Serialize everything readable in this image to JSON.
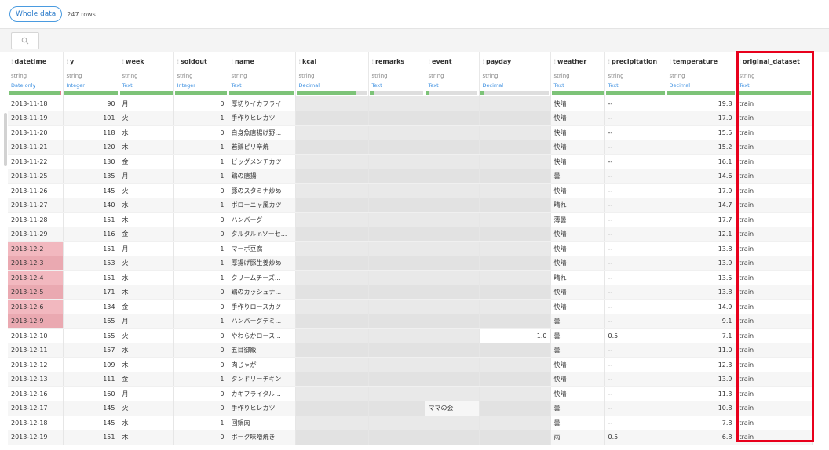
{
  "toolbar": {
    "view_label": "Whole data",
    "row_count": "247 rows"
  },
  "search": {
    "icon": "search-icon"
  },
  "columns": [
    {
      "name": "datetime",
      "type": "string",
      "role": "Date only",
      "valid": 0.97,
      "invalid": 0.03,
      "missing": 0
    },
    {
      "name": "y",
      "type": "string",
      "role": "Integer",
      "valid": 1,
      "invalid": 0,
      "missing": 0
    },
    {
      "name": "week",
      "type": "string",
      "role": "Text",
      "valid": 1,
      "invalid": 0,
      "missing": 0
    },
    {
      "name": "soldout",
      "type": "string",
      "role": "Integer",
      "valid": 1,
      "invalid": 0,
      "missing": 0
    },
    {
      "name": "name",
      "type": "string",
      "role": "Text",
      "valid": 1,
      "invalid": 0,
      "missing": 0
    },
    {
      "name": "kcal",
      "type": "string",
      "role": "Decimal",
      "valid": 0.85,
      "invalid": 0,
      "missing": 0.15
    },
    {
      "name": "remarks",
      "type": "string",
      "role": "Text",
      "valid": 0.1,
      "invalid": 0,
      "missing": 0.9
    },
    {
      "name": "event",
      "type": "string",
      "role": "Text",
      "valid": 0.07,
      "invalid": 0,
      "missing": 0.93
    },
    {
      "name": "payday",
      "type": "string",
      "role": "Decimal",
      "valid": 0.05,
      "invalid": 0,
      "missing": 0.95
    },
    {
      "name": "weather",
      "type": "string",
      "role": "Text",
      "valid": 1,
      "invalid": 0,
      "missing": 0
    },
    {
      "name": "precipitation",
      "type": "string",
      "role": "Text",
      "valid": 1,
      "invalid": 0,
      "missing": 0
    },
    {
      "name": "temperature",
      "type": "string",
      "role": "Decimal",
      "valid": 1,
      "invalid": 0,
      "missing": 0
    },
    {
      "name": "original_dataset",
      "type": "string",
      "role": "Text",
      "valid": 1,
      "invalid": 0,
      "missing": 0
    }
  ],
  "rows": [
    {
      "datetime": "2013-11-18",
      "y": "90",
      "week": "月",
      "soldout": "0",
      "name": "厚切りイカフライ",
      "kcal": "",
      "remarks": "",
      "event": "",
      "payday": "",
      "weather": "快晴",
      "precipitation": "--",
      "temperature": "19.8",
      "original_dataset": "train"
    },
    {
      "datetime": "2013-11-19",
      "y": "101",
      "week": "火",
      "soldout": "1",
      "name": "手作りヒレカツ",
      "kcal": "",
      "remarks": "",
      "event": "",
      "payday": "",
      "weather": "快晴",
      "precipitation": "--",
      "temperature": "17.0",
      "original_dataset": "train"
    },
    {
      "datetime": "2013-11-20",
      "y": "118",
      "week": "水",
      "soldout": "0",
      "name": "白身魚唐揚げ野...",
      "kcal": "",
      "remarks": "",
      "event": "",
      "payday": "",
      "weather": "快晴",
      "precipitation": "--",
      "temperature": "15.5",
      "original_dataset": "train"
    },
    {
      "datetime": "2013-11-21",
      "y": "120",
      "week": "木",
      "soldout": "1",
      "name": "若鶏ピリ辛焼",
      "kcal": "",
      "remarks": "",
      "event": "",
      "payday": "",
      "weather": "快晴",
      "precipitation": "--",
      "temperature": "15.2",
      "original_dataset": "train"
    },
    {
      "datetime": "2013-11-22",
      "y": "130",
      "week": "金",
      "soldout": "1",
      "name": "ビッグメンチカツ",
      "kcal": "",
      "remarks": "",
      "event": "",
      "payday": "",
      "weather": "快晴",
      "precipitation": "--",
      "temperature": "16.1",
      "original_dataset": "train"
    },
    {
      "datetime": "2013-11-25",
      "y": "135",
      "week": "月",
      "soldout": "1",
      "name": "鶏の唐揚",
      "kcal": "",
      "remarks": "",
      "event": "",
      "payday": "",
      "weather": "曇",
      "precipitation": "--",
      "temperature": "14.6",
      "original_dataset": "train"
    },
    {
      "datetime": "2013-11-26",
      "y": "145",
      "week": "火",
      "soldout": "0",
      "name": "豚のスタミナ炒め",
      "kcal": "",
      "remarks": "",
      "event": "",
      "payday": "",
      "weather": "快晴",
      "precipitation": "--",
      "temperature": "17.9",
      "original_dataset": "train"
    },
    {
      "datetime": "2013-11-27",
      "y": "140",
      "week": "水",
      "soldout": "1",
      "name": "ボローニャ風カツ",
      "kcal": "",
      "remarks": "",
      "event": "",
      "payday": "",
      "weather": "晴れ",
      "precipitation": "--",
      "temperature": "14.7",
      "original_dataset": "train"
    },
    {
      "datetime": "2013-11-28",
      "y": "151",
      "week": "木",
      "soldout": "0",
      "name": "ハンバーグ",
      "kcal": "",
      "remarks": "",
      "event": "",
      "payday": "",
      "weather": "薄曇",
      "precipitation": "--",
      "temperature": "17.7",
      "original_dataset": "train"
    },
    {
      "datetime": "2013-11-29",
      "y": "116",
      "week": "金",
      "soldout": "0",
      "name": "タルタルinソーセ...",
      "kcal": "",
      "remarks": "",
      "event": "",
      "payday": "",
      "weather": "快晴",
      "precipitation": "--",
      "temperature": "12.1",
      "original_dataset": "train"
    },
    {
      "datetime": "2013-12-2",
      "y": "151",
      "week": "月",
      "soldout": "1",
      "name": "マーボ豆腐",
      "kcal": "",
      "remarks": "",
      "event": "",
      "payday": "",
      "weather": "快晴",
      "precipitation": "--",
      "temperature": "13.8",
      "original_dataset": "train",
      "invalid_datetime": true
    },
    {
      "datetime": "2013-12-3",
      "y": "153",
      "week": "火",
      "soldout": "1",
      "name": "厚揚げ豚生姜炒め",
      "kcal": "",
      "remarks": "",
      "event": "",
      "payday": "",
      "weather": "快晴",
      "precipitation": "--",
      "temperature": "13.9",
      "original_dataset": "train",
      "invalid_datetime": true
    },
    {
      "datetime": "2013-12-4",
      "y": "151",
      "week": "水",
      "soldout": "1",
      "name": "クリームチーズ...",
      "kcal": "",
      "remarks": "",
      "event": "",
      "payday": "",
      "weather": "晴れ",
      "precipitation": "--",
      "temperature": "13.5",
      "original_dataset": "train",
      "invalid_datetime": true
    },
    {
      "datetime": "2013-12-5",
      "y": "171",
      "week": "木",
      "soldout": "0",
      "name": "鶏のカッシュナ...",
      "kcal": "",
      "remarks": "",
      "event": "",
      "payday": "",
      "weather": "快晴",
      "precipitation": "--",
      "temperature": "13.8",
      "original_dataset": "train",
      "invalid_datetime": true
    },
    {
      "datetime": "2013-12-6",
      "y": "134",
      "week": "金",
      "soldout": "0",
      "name": "手作りロースカツ",
      "kcal": "",
      "remarks": "",
      "event": "",
      "payday": "",
      "weather": "快晴",
      "precipitation": "--",
      "temperature": "14.9",
      "original_dataset": "train",
      "invalid_datetime": true
    },
    {
      "datetime": "2013-12-9",
      "y": "165",
      "week": "月",
      "soldout": "1",
      "name": "ハンバーグデミ...",
      "kcal": "",
      "remarks": "",
      "event": "",
      "payday": "",
      "weather": "曇",
      "precipitation": "--",
      "temperature": "9.1",
      "original_dataset": "train",
      "invalid_datetime": true
    },
    {
      "datetime": "2013-12-10",
      "y": "155",
      "week": "火",
      "soldout": "0",
      "name": "やわらかロース...",
      "kcal": "",
      "remarks": "",
      "event": "",
      "payday": "1.0",
      "weather": "曇",
      "precipitation": "0.5",
      "temperature": "7.1",
      "original_dataset": "train"
    },
    {
      "datetime": "2013-12-11",
      "y": "157",
      "week": "水",
      "soldout": "0",
      "name": "五目御飯",
      "kcal": "",
      "remarks": "",
      "event": "",
      "payday": "",
      "weather": "曇",
      "precipitation": "--",
      "temperature": "11.0",
      "original_dataset": "train"
    },
    {
      "datetime": "2013-12-12",
      "y": "109",
      "week": "木",
      "soldout": "0",
      "name": "肉じゃが",
      "kcal": "",
      "remarks": "",
      "event": "",
      "payday": "",
      "weather": "快晴",
      "precipitation": "--",
      "temperature": "12.3",
      "original_dataset": "train"
    },
    {
      "datetime": "2013-12-13",
      "y": "111",
      "week": "金",
      "soldout": "1",
      "name": "タンドリーチキン",
      "kcal": "",
      "remarks": "",
      "event": "",
      "payday": "",
      "weather": "快晴",
      "precipitation": "--",
      "temperature": "13.9",
      "original_dataset": "train"
    },
    {
      "datetime": "2013-12-16",
      "y": "160",
      "week": "月",
      "soldout": "0",
      "name": "カキフライタル...",
      "kcal": "",
      "remarks": "",
      "event": "",
      "payday": "",
      "weather": "快晴",
      "precipitation": "--",
      "temperature": "11.3",
      "original_dataset": "train"
    },
    {
      "datetime": "2013-12-17",
      "y": "145",
      "week": "火",
      "soldout": "0",
      "name": "手作りヒレカツ",
      "kcal": "",
      "remarks": "",
      "event": "ママの会",
      "payday": "",
      "weather": "曇",
      "precipitation": "--",
      "temperature": "10.8",
      "original_dataset": "train"
    },
    {
      "datetime": "2013-12-18",
      "y": "145",
      "week": "水",
      "soldout": "1",
      "name": "回鍋肉",
      "kcal": "",
      "remarks": "",
      "event": "",
      "payday": "",
      "weather": "曇",
      "precipitation": "--",
      "temperature": "7.8",
      "original_dataset": "train"
    },
    {
      "datetime": "2013-12-19",
      "y": "151",
      "week": "木",
      "soldout": "0",
      "name": "ポーク味噌焼き",
      "kcal": "",
      "remarks": "",
      "event": "",
      "payday": "",
      "weather": "雨",
      "precipitation": "0.5",
      "temperature": "6.8",
      "original_dataset": "train"
    }
  ],
  "colors": {
    "valid": "#7dc378",
    "invalid": "#e07d8b",
    "missing": "#dedede",
    "highlight": "#e8001c"
  }
}
